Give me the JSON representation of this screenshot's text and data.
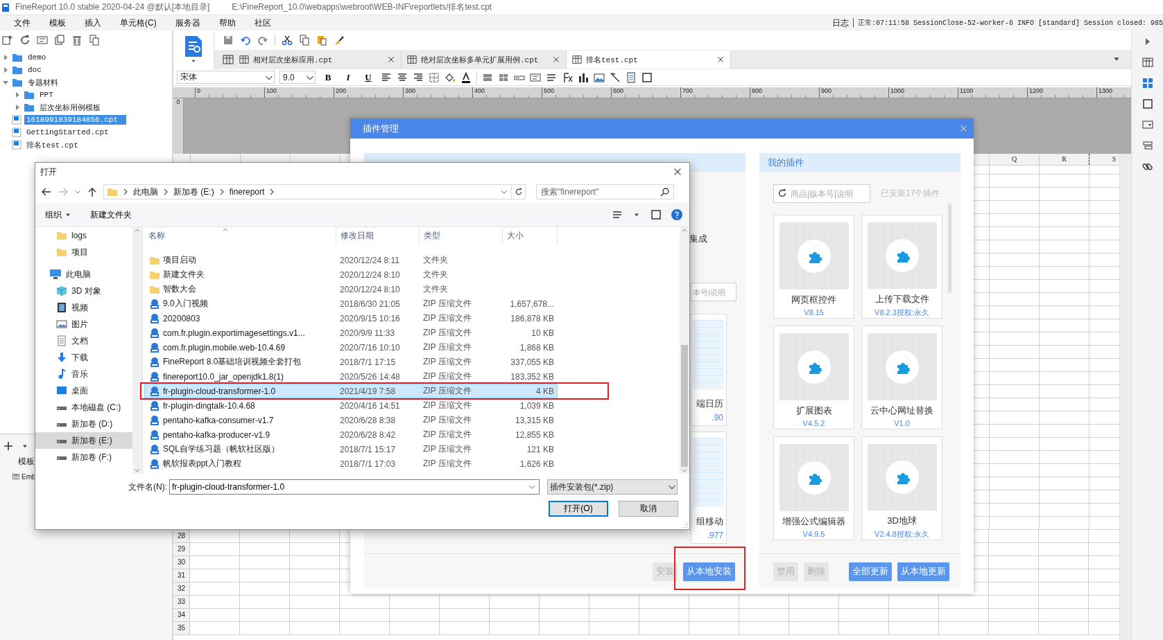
{
  "title_bar": {
    "app": "FineReport 10.0 stable 2020-04-24 @默认[本地目录]",
    "path": "E:\\FineReport_10.0\\webapps\\webroot\\WEB-INF\\reportlets/排名test.cpt"
  },
  "menu": [
    "文件",
    "模板",
    "插入",
    "单元格(C)",
    "服务器",
    "帮助",
    "社区"
  ],
  "log": {
    "label": "日志",
    "message": "正常:07:11:58 SessionClose-52-worker-6 INFO [standard] Session closed: 985"
  },
  "file_tree": [
    {
      "kind": "folder",
      "label": "demo",
      "expanded": false,
      "selected": false
    },
    {
      "kind": "folder",
      "label": "doc",
      "expanded": false,
      "selected": false
    },
    {
      "kind": "folder",
      "label": "专题材料",
      "expanded": true,
      "selected": false,
      "children": [
        {
          "kind": "folder",
          "label": "PPT",
          "expanded": false,
          "selected": false
        },
        {
          "kind": "folder",
          "label": "层次坐标用例模板",
          "expanded": false,
          "selected": false
        }
      ]
    },
    {
      "kind": "file",
      "label": "1618991839184856.cpt",
      "selected": true
    },
    {
      "kind": "file",
      "label": "GettingStarted.cpt",
      "selected": false
    },
    {
      "kind": "file",
      "label": "排名test.cpt",
      "selected": false
    }
  ],
  "template_panel": {
    "label": "模板",
    "item": "Emb"
  },
  "tabs": [
    {
      "label": "相对层次坐标应用.cpt",
      "selected": false
    },
    {
      "label": "绝对层次坐标多单元扩展用例.cpt",
      "selected": false
    },
    {
      "label": "排名test.cpt",
      "selected": true
    }
  ],
  "format_bar": {
    "font": "宋体",
    "size": "9.0",
    "style_buttons": [
      "B",
      "I",
      "U"
    ]
  },
  "ruler": [
    "0",
    "100",
    "200",
    "300",
    "400",
    "500",
    "600",
    "700",
    "800",
    "900",
    "1000",
    "1100",
    "1200",
    "1300"
  ],
  "vertical_ruler": "0",
  "sheet": {
    "columns": [
      "Q",
      "R",
      "S"
    ],
    "rows": [
      "28",
      "29",
      "30",
      "31",
      "32",
      "33",
      "34",
      "35"
    ]
  },
  "plugin_manager": {
    "title": "插件管理",
    "store": {
      "section_label": "集成",
      "search_placeholder": "本号|说明",
      "plugins": [
        {
          "name": "端日历",
          "version": ".90"
        },
        {
          "name": "组移动",
          "version": ".977"
        }
      ],
      "buttons": [
        {
          "label": "安装",
          "kind": "plain",
          "disabled": true
        },
        {
          "label": "从本地安装",
          "kind": "primary",
          "disabled": false
        }
      ]
    },
    "mine": {
      "title": "我的插件",
      "search_placeholder": "商品|版本号|说明",
      "count": "已安装17个插件",
      "plugins": [
        {
          "name": "网页框控件",
          "version": "V8.15"
        },
        {
          "name": "上传下载文件",
          "version": "V8.2.3授权:永久"
        },
        {
          "name": "扩展图表",
          "version": "V4.5.2"
        },
        {
          "name": "云中心网址替换",
          "version": "V1.0"
        },
        {
          "name": "增强公式编辑器",
          "version": "V4.9.5"
        },
        {
          "name": "3D地球",
          "version": "V2.4.8授权:永久"
        }
      ],
      "buttons": [
        {
          "label": "禁用",
          "kind": "plain",
          "disabled": true
        },
        {
          "label": "删除",
          "kind": "plain",
          "disabled": true
        },
        {
          "label": "全部更新",
          "kind": "primary",
          "disabled": false
        },
        {
          "label": "从本地更新",
          "kind": "primary",
          "disabled": false
        }
      ]
    }
  },
  "open_dialog": {
    "title": "打开",
    "path": [
      "此电脑",
      "新加卷 (E:)",
      "finereport"
    ],
    "search_placeholder": "搜索\"finereport\"",
    "commands": [
      "组织",
      "新建文件夹"
    ],
    "nav": [
      {
        "kind": "folder",
        "label": "logs",
        "selected": false
      },
      {
        "kind": "folder",
        "label": "项目",
        "selected": false
      },
      {
        "kind": "pc",
        "label": "此电脑",
        "selected": false,
        "children": [
          {
            "kind": "cube",
            "label": "3D 对象",
            "selected": false
          },
          {
            "kind": "video",
            "label": "视频",
            "selected": false
          },
          {
            "kind": "picture",
            "label": "图片",
            "selected": false
          },
          {
            "kind": "document",
            "label": "文档",
            "selected": false
          },
          {
            "kind": "download",
            "label": "下载",
            "selected": false
          },
          {
            "kind": "music",
            "label": "音乐",
            "selected": false
          },
          {
            "kind": "desktop",
            "label": "桌面",
            "selected": false
          },
          {
            "kind": "drive",
            "label": "本地磁盘 (C:)",
            "selected": false
          },
          {
            "kind": "drive",
            "label": "新加卷 (D:)",
            "selected": false
          },
          {
            "kind": "drive",
            "label": "新加卷 (E:)",
            "selected": true
          },
          {
            "kind": "drive",
            "label": "新加卷 (F:)",
            "selected": false
          }
        ]
      }
    ],
    "columns": [
      "名称",
      "修改日期",
      "类型",
      "大小"
    ],
    "files": [
      {
        "kind": "folder",
        "name": "项目启动",
        "modified": "2020/12/24 8:11",
        "type": "文件夹",
        "selected": false
      },
      {
        "kind": "folder",
        "name": "新建文件夹",
        "modified": "2020/12/24 8:10",
        "type": "文件夹",
        "selected": false
      },
      {
        "kind": "folder",
        "name": "智数大会",
        "modified": "2020/12/24 8:10",
        "type": "文件夹",
        "selected": false
      },
      {
        "kind": "zip",
        "name": "9.0入门视频",
        "modified": "2018/6/30 21:05",
        "type": "ZIP 压缩文件",
        "size": "1,657,678...",
        "selected": false
      },
      {
        "kind": "zip",
        "name": "20200803",
        "modified": "2020/9/15 10:16",
        "type": "ZIP 压缩文件",
        "size": "186,878 KB",
        "selected": false
      },
      {
        "kind": "zip",
        "name": "com.fr.plugin.exportimagesettings.v1...",
        "modified": "2020/9/9 11:33",
        "type": "ZIP 压缩文件",
        "size": "10 KB",
        "selected": false
      },
      {
        "kind": "zip",
        "name": "com.fr.plugin.mobile.web-10.4.69",
        "modified": "2020/7/16 10:10",
        "type": "ZIP 压缩文件",
        "size": "1,868 KB",
        "selected": false
      },
      {
        "kind": "zip",
        "name": "FineReport 8.0基础培训视频全套打包",
        "modified": "2018/7/1 17:15",
        "type": "ZIP 压缩文件",
        "size": "337,055 KB",
        "selected": false
      },
      {
        "kind": "zip",
        "name": "finereport10.0_jar_openjdk1.8(1)",
        "modified": "2020/5/26 14:48",
        "type": "ZIP 压缩文件",
        "size": "183,352 KB",
        "selected": false
      },
      {
        "kind": "zip",
        "name": "fr-plugin-cloud-transformer-1.0",
        "modified": "2021/4/19 7:58",
        "type": "ZIP 压缩文件",
        "size": "4 KB",
        "selected": true
      },
      {
        "kind": "zip",
        "name": "fr-plugin-dingtalk-10.4.68",
        "modified": "2020/4/16 14:51",
        "type": "ZIP 压缩文件",
        "size": "1,039 KB",
        "selected": false
      },
      {
        "kind": "zip",
        "name": "pentaho-kafka-consumer-v1.7",
        "modified": "2020/6/28 8:38",
        "type": "ZIP 压缩文件",
        "size": "13,315 KB",
        "selected": false
      },
      {
        "kind": "zip",
        "name": "pentaho-kafka-producer-v1.9",
        "modified": "2020/6/28 8:42",
        "type": "ZIP 压缩文件",
        "size": "12,855 KB",
        "selected": false
      },
      {
        "kind": "zip",
        "name": "SQL自学练习题（帆软社区版）",
        "modified": "2018/7/1 15:17",
        "type": "ZIP 压缩文件",
        "size": "121 KB",
        "selected": false
      },
      {
        "kind": "zip",
        "name": "帆软报表ppt入门教程",
        "modified": "2018/7/1 17:03",
        "type": "ZIP 压缩文件",
        "size": "1,626 KB",
        "selected": false
      }
    ],
    "filename_label": "文件名(N):",
    "filename": "fr-plugin-cloud-transformer-1.0",
    "filter": "插件安装包(*.zip)",
    "buttons": [
      {
        "label": "打开(O)",
        "kind": "default"
      },
      {
        "label": "取消",
        "kind": "normal"
      }
    ]
  }
}
